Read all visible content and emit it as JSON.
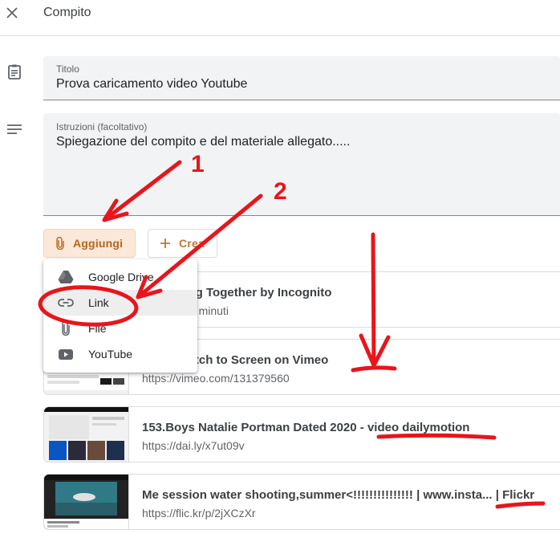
{
  "header": {
    "title": "Compito"
  },
  "title_field": {
    "label": "Titolo",
    "value": "Prova caricamento video Youtube"
  },
  "instructions_field": {
    "label": "Istruzioni (facoltativo)",
    "value": "Spiegazione del compito e del materiale allegato....."
  },
  "buttons": {
    "add_label": "Aggiungi",
    "create_label": "Crea"
  },
  "menu": {
    "items": [
      {
        "label": "Google Drive",
        "icon": "google-drive-icon"
      },
      {
        "label": "Link",
        "icon": "link-icon"
      },
      {
        "label": "File",
        "icon": "paperclip-icon"
      },
      {
        "label": "YouTube",
        "icon": "youtube-icon"
      }
    ]
  },
  "attachments": [
    {
      "title": "This Thing Together by Incognito",
      "meta": "YouTube   7 minuti"
    },
    {
      "title": "dick: Sketch to Screen on Vimeo",
      "url": "https://vimeo.com/131379560"
    },
    {
      "title": "153.Boys Natalie Portman Dated 2020 - video dailymotion",
      "url": "https://dai.ly/x7ut09v"
    },
    {
      "title": "Me session water shooting,summer<!!!!!!!!!!!!!!! | www.insta... | Flickr",
      "url": "https://flic.kr/p/2jXCzXr"
    }
  ],
  "annotations": {
    "one": "1",
    "two": "2"
  },
  "colors": {
    "accent": "#c26401",
    "annotation": "#e8151b"
  }
}
